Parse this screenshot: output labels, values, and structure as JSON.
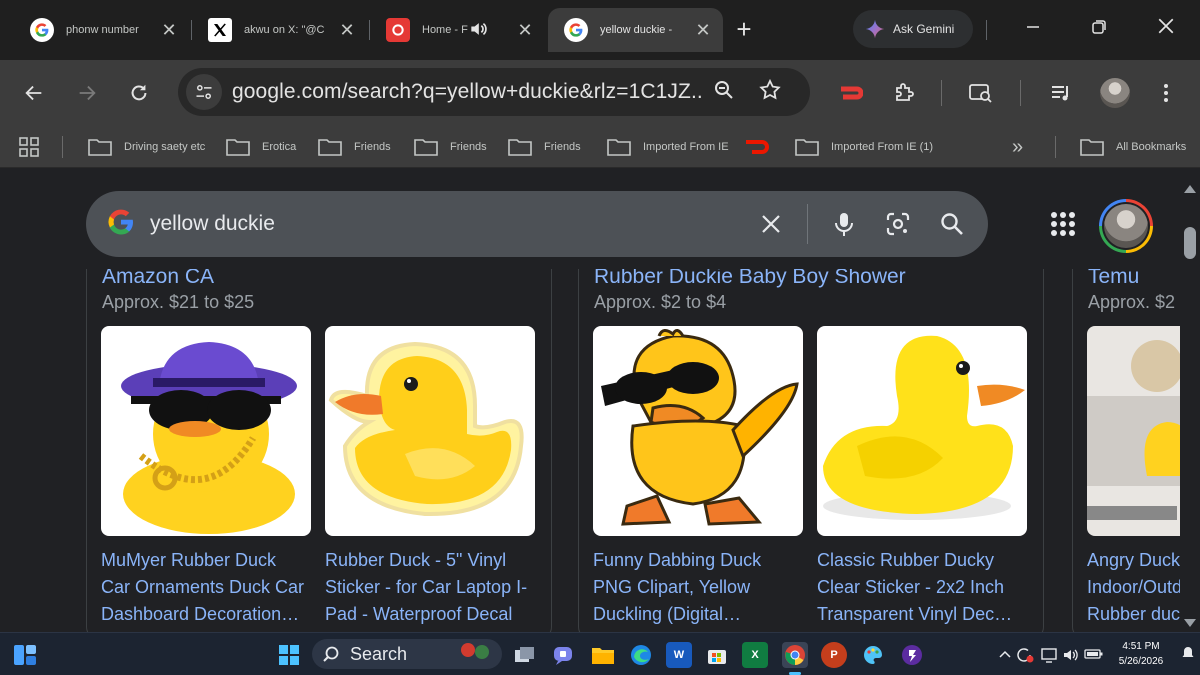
{
  "browser": {
    "tabs": [
      {
        "title": "phonw number",
        "favicon": "google-icon"
      },
      {
        "title": "akwu on X: \"@C",
        "favicon": "x-icon"
      },
      {
        "title": "Home - F",
        "favicon": "roku-icon"
      },
      {
        "title": "yellow duckie -",
        "favicon": "google-icon"
      }
    ],
    "gemini_label": "Ask Gemini",
    "url": "google.com/search?q=yellow+duckie&rlz=1C1JZ..."
  },
  "bookmarks": [
    {
      "label": "Driving saety etc"
    },
    {
      "label": "Erotica"
    },
    {
      "label": "Friends"
    },
    {
      "label": "Friends"
    },
    {
      "label": "Friends"
    },
    {
      "label": "Imported From IE"
    },
    {
      "label": ""
    },
    {
      "label": "Imported From IE (1)"
    }
  ],
  "bookmarks_overflow": "»",
  "all_bookmarks": "All Bookmarks",
  "search": {
    "query": "yellow duckie"
  },
  "results": [
    {
      "store": "Amazon CA",
      "price": "Approx. $21 to $25",
      "products": [
        {
          "title_lines": [
            "MuMyer Rubber Duck",
            "Car Ornaments Duck Car",
            "Dashboard Decoration…"
          ]
        },
        {
          "title_lines": [
            "Rubber Duck - 5\" Vinyl",
            "Sticker - for Car Laptop I-",
            "Pad - Waterproof Decal"
          ]
        }
      ]
    },
    {
      "store": "Rubber Duckie Baby Boy Shower",
      "price": "Approx. $2 to $4",
      "products": [
        {
          "title_lines": [
            "Funny Dabbing Duck",
            "PNG Clipart, Yellow",
            "Duckling (Digital…"
          ]
        },
        {
          "title_lines": [
            "Classic Rubber Ducky",
            "Clear Sticker - 2x2 Inch",
            "Transparent Vinyl Dec…"
          ]
        }
      ]
    },
    {
      "store": "Temu",
      "price": "Approx. $2",
      "products": [
        {
          "title_lines": [
            "Angry Duck",
            "Indoor/Outd",
            "Rubber duc"
          ]
        }
      ]
    }
  ],
  "taskbar": {
    "search_label": "Search",
    "time": "4:51 PM",
    "date": "5/26/2026"
  },
  "colors": {
    "link": "#8ab4f8",
    "page_bg": "#202124",
    "duck_yellow": "#ffd21f",
    "beak_orange": "#f08a24"
  }
}
